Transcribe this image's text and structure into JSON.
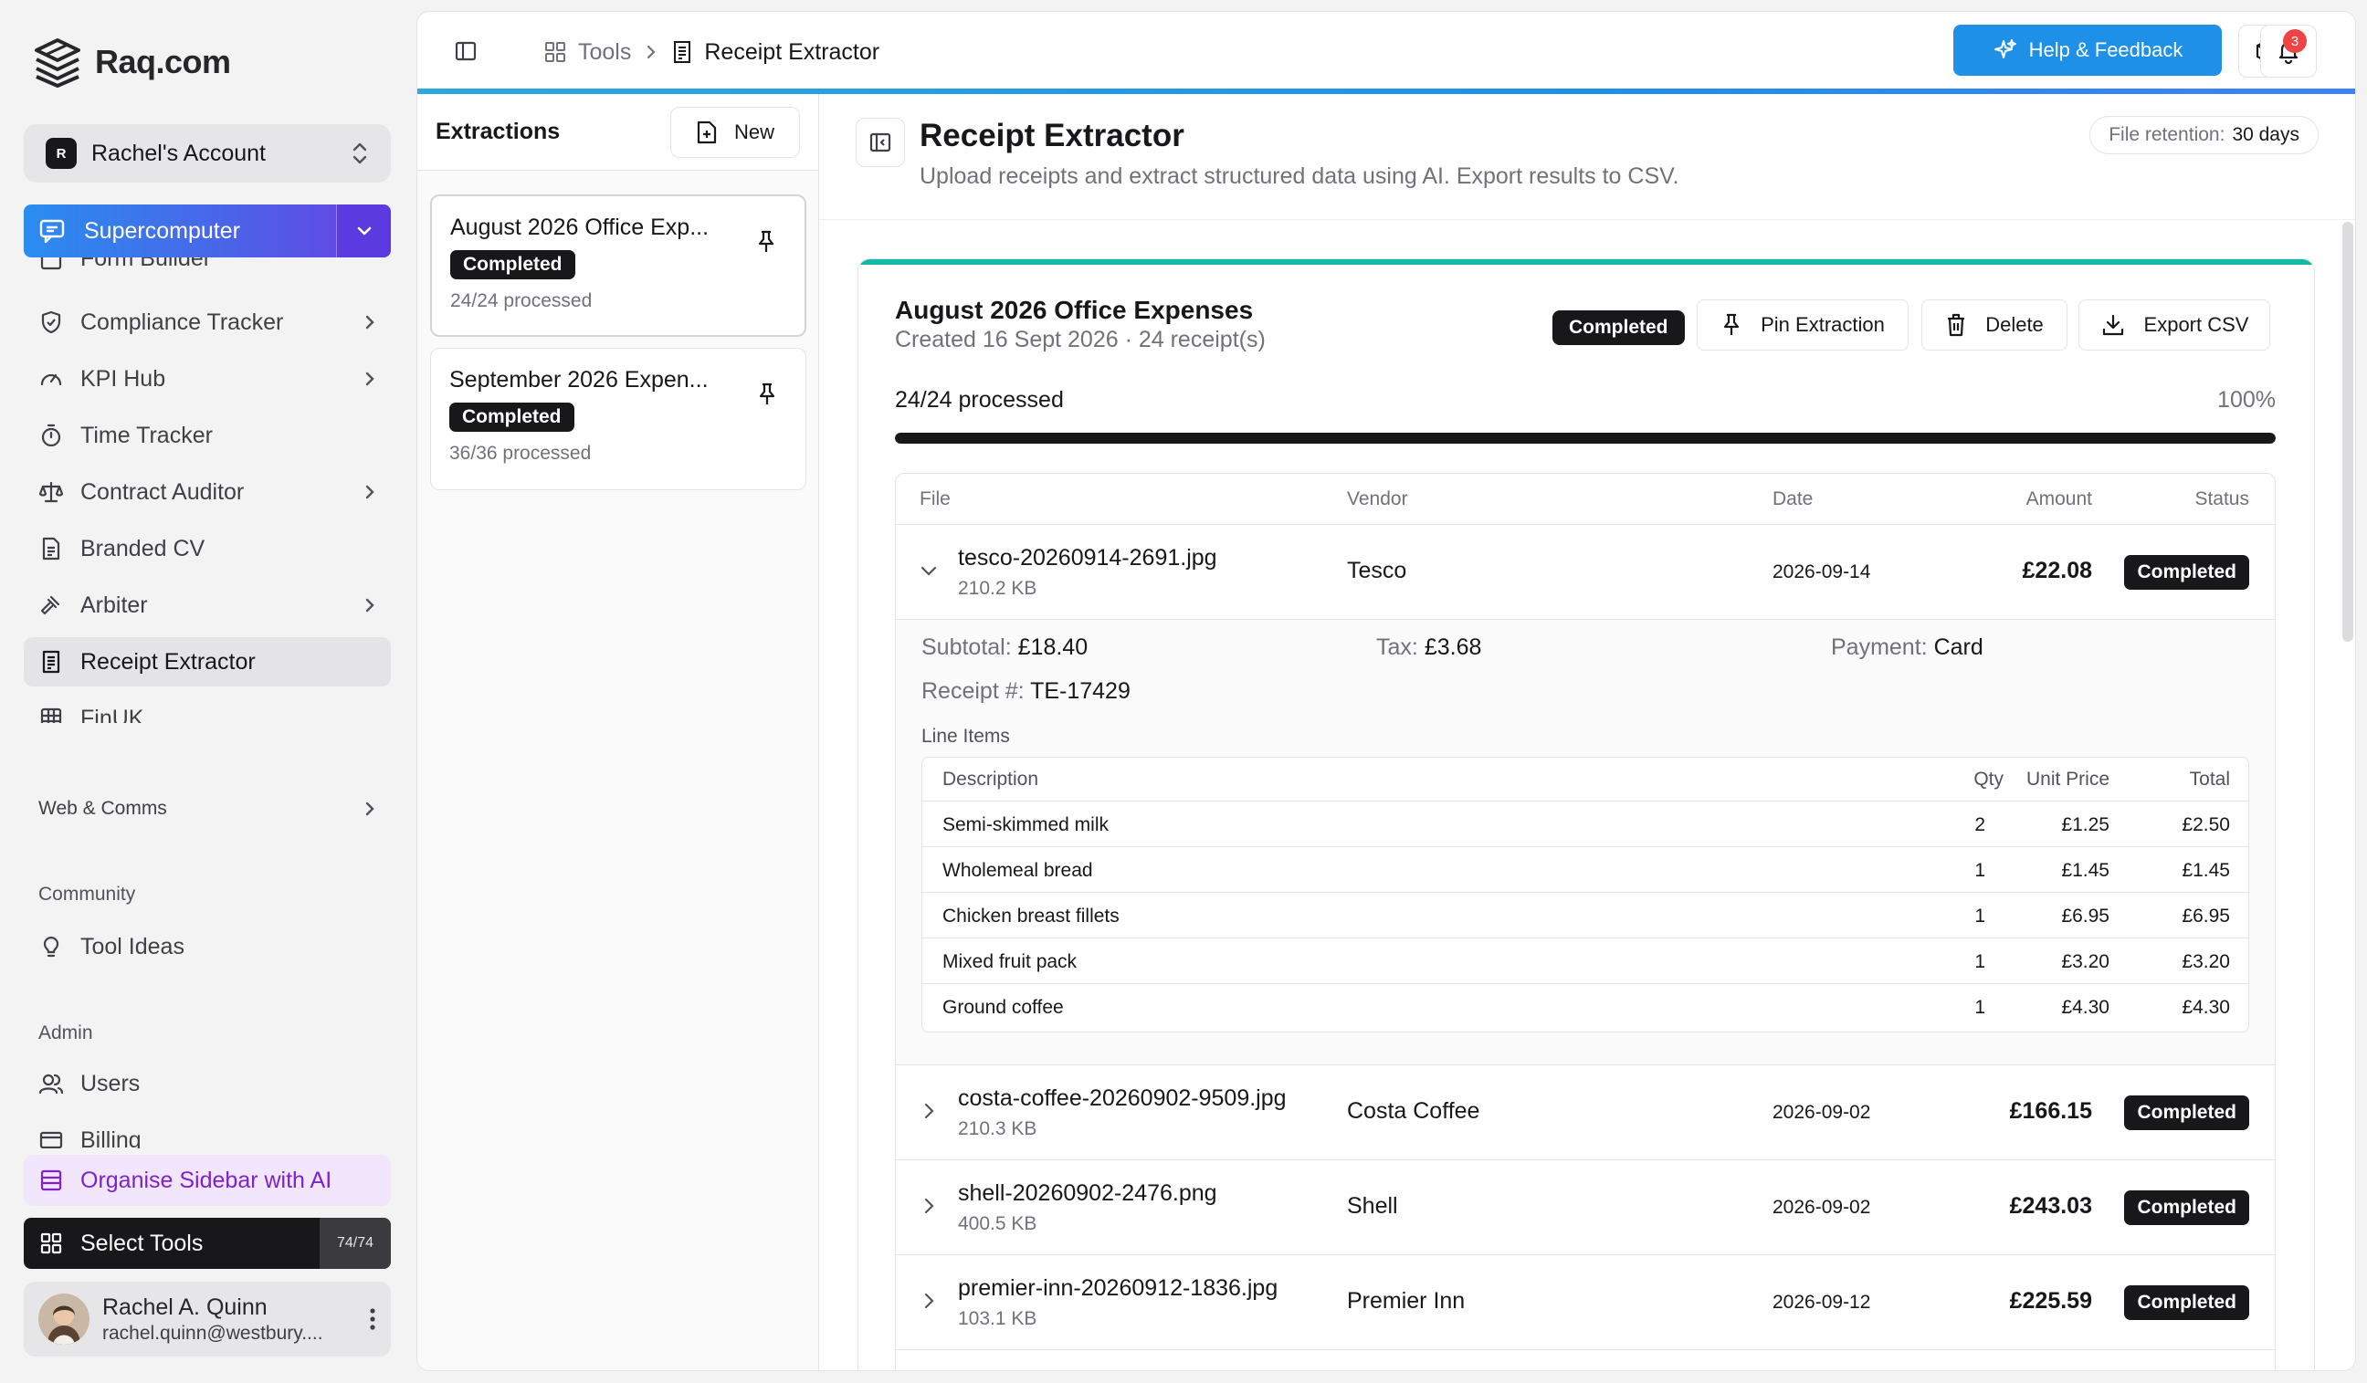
{
  "brand": {
    "name": "Raq.com"
  },
  "account": {
    "initial": "R",
    "name": "Rachel's Account"
  },
  "supercomputer": {
    "label": "Supercomputer"
  },
  "sidebar": {
    "items": [
      {
        "label": "Form Builder",
        "icon": "form-icon",
        "chevron": false
      },
      {
        "label": "Compliance Tracker",
        "icon": "shield-icon",
        "chevron": true
      },
      {
        "label": "KPI Hub",
        "icon": "gauge-icon",
        "chevron": true
      },
      {
        "label": "Time Tracker",
        "icon": "stopwatch-icon",
        "chevron": false
      },
      {
        "label": "Contract Auditor",
        "icon": "scale-icon",
        "chevron": true
      },
      {
        "label": "Branded CV",
        "icon": "document-icon",
        "chevron": false
      },
      {
        "label": "Arbiter",
        "icon": "gavel-icon",
        "chevron": true
      },
      {
        "label": "Receipt Extractor",
        "icon": "receipt-icon",
        "chevron": false,
        "active": true
      },
      {
        "label": "FinUK",
        "icon": "grid-icon",
        "chevron": false
      }
    ],
    "web_comms": "Web & Comms",
    "community_label": "Community",
    "tool_ideas": "Tool Ideas",
    "admin_label": "Admin",
    "users": "Users",
    "billing": "Billing",
    "organise": "Organise Sidebar with AI",
    "select_tools": "Select Tools",
    "tools_count": "74/74"
  },
  "user": {
    "name": "Rachel A. Quinn",
    "email": "rachel.quinn@westbury...."
  },
  "topbar": {
    "crumb_tools": "Tools",
    "crumb_current": "Receipt Extractor",
    "help": "Help & Feedback",
    "notifications": "3"
  },
  "extractions": {
    "title": "Extractions",
    "new_label": "New",
    "items": [
      {
        "title": "August 2026 Office Exp...",
        "status": "Completed",
        "processed": "24/24 processed"
      },
      {
        "title": "September 2026 Expen...",
        "status": "Completed",
        "processed": "36/36 processed"
      }
    ]
  },
  "page": {
    "title": "Receipt Extractor",
    "description": "Upload receipts and extract structured data using AI. Export results to CSV.",
    "retention_label": "File retention:",
    "retention_value": "30 days"
  },
  "extraction": {
    "title": "August 2026 Office Expenses",
    "subtitle": "Created 16 Sept 2026 · 24 receipt(s)",
    "status": "Completed",
    "pin_label": "Pin Extraction",
    "delete_label": "Delete",
    "export_label": "Export CSV",
    "progress_text": "24/24 processed",
    "progress_pct": "100%",
    "progress_fraction": 1.0
  },
  "table": {
    "headers": {
      "file": "File",
      "vendor": "Vendor",
      "date": "Date",
      "amount": "Amount",
      "status": "Status"
    },
    "rows": [
      {
        "file": "tesco-20260914-2691.jpg",
        "size": "210.2 KB",
        "vendor": "Tesco",
        "date": "2026-09-14",
        "amount": "£22.08",
        "status": "Completed",
        "expanded": true
      },
      {
        "file": "costa-coffee-20260902-9509.jpg",
        "size": "210.3 KB",
        "vendor": "Costa Coffee",
        "date": "2026-09-02",
        "amount": "£166.15",
        "status": "Completed"
      },
      {
        "file": "shell-20260902-2476.png",
        "size": "400.5 KB",
        "vendor": "Shell",
        "date": "2026-09-02",
        "amount": "£243.03",
        "status": "Completed"
      },
      {
        "file": "premier-inn-20260912-1836.jpg",
        "size": "103.1 KB",
        "vendor": "Premier Inn",
        "date": "2026-09-12",
        "amount": "£225.59",
        "status": "Completed"
      }
    ]
  },
  "detail": {
    "subtotal_label": "Subtotal:",
    "subtotal": "£18.40",
    "tax_label": "Tax:",
    "tax": "£3.68",
    "payment_label": "Payment:",
    "payment": "Card",
    "receipt_label": "Receipt #:",
    "receipt": "TE-17429",
    "line_items_label": "Line Items",
    "li_headers": {
      "description": "Description",
      "qty": "Qty",
      "unit": "Unit Price",
      "total": "Total"
    },
    "line_items": [
      {
        "description": "Semi-skimmed milk",
        "qty": "2",
        "unit": "£1.25",
        "total": "£2.50"
      },
      {
        "description": "Wholemeal bread",
        "qty": "1",
        "unit": "£1.45",
        "total": "£1.45"
      },
      {
        "description": "Chicken breast fillets",
        "qty": "1",
        "unit": "£6.95",
        "total": "£6.95"
      },
      {
        "description": "Mixed fruit pack",
        "qty": "1",
        "unit": "£3.20",
        "total": "£3.20"
      },
      {
        "description": "Ground coffee",
        "qty": "1",
        "unit": "£4.30",
        "total": "£4.30"
      }
    ]
  }
}
